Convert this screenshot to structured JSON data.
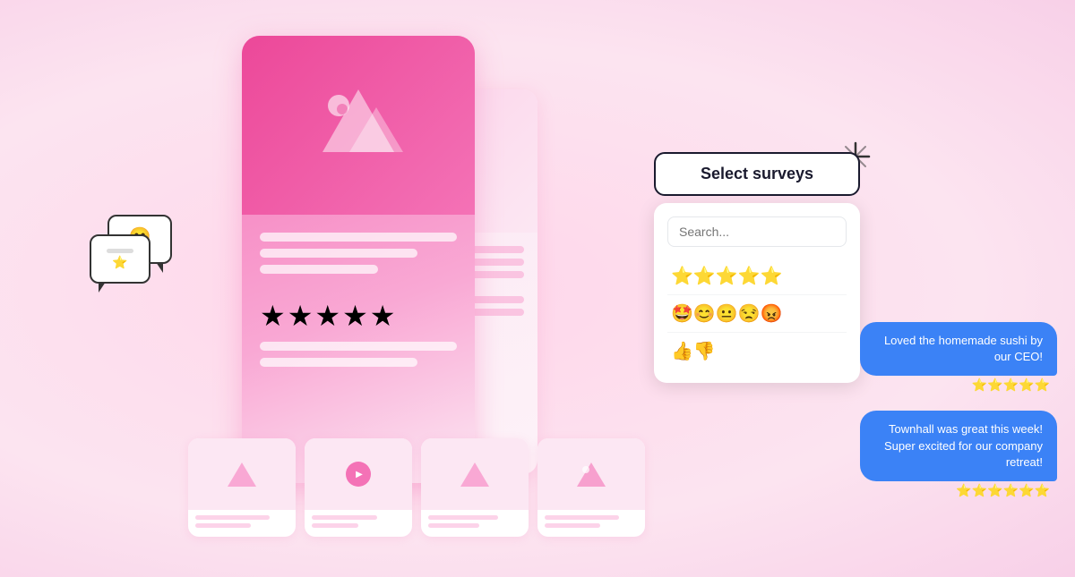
{
  "background_color": "#fce4f0",
  "select_surveys": {
    "label": "Select surveys",
    "search_placeholder": "Search...",
    "survey_rows": [
      {
        "icons": "⭐⭐⭐⭐⭐",
        "id": "stars"
      },
      {
        "icons": "🤩😊😐😒😡",
        "id": "faces"
      },
      {
        "icons": "👍👎",
        "id": "thumbs"
      }
    ]
  },
  "chat_messages": [
    {
      "text": "Loved the homemade sushi by our CEO!",
      "stars": "⭐⭐⭐⭐⭐"
    },
    {
      "text": "Townhall was great this week! Super excited for our company retreat!",
      "stars": "⭐⭐⭐⭐⭐⭐"
    }
  ],
  "card": {
    "stars": "★★★★★"
  },
  "sparkle_label": "✦",
  "icons": {
    "mountain": "mountain-icon",
    "smiley": "😊",
    "star": "⭐",
    "play": "▶"
  }
}
